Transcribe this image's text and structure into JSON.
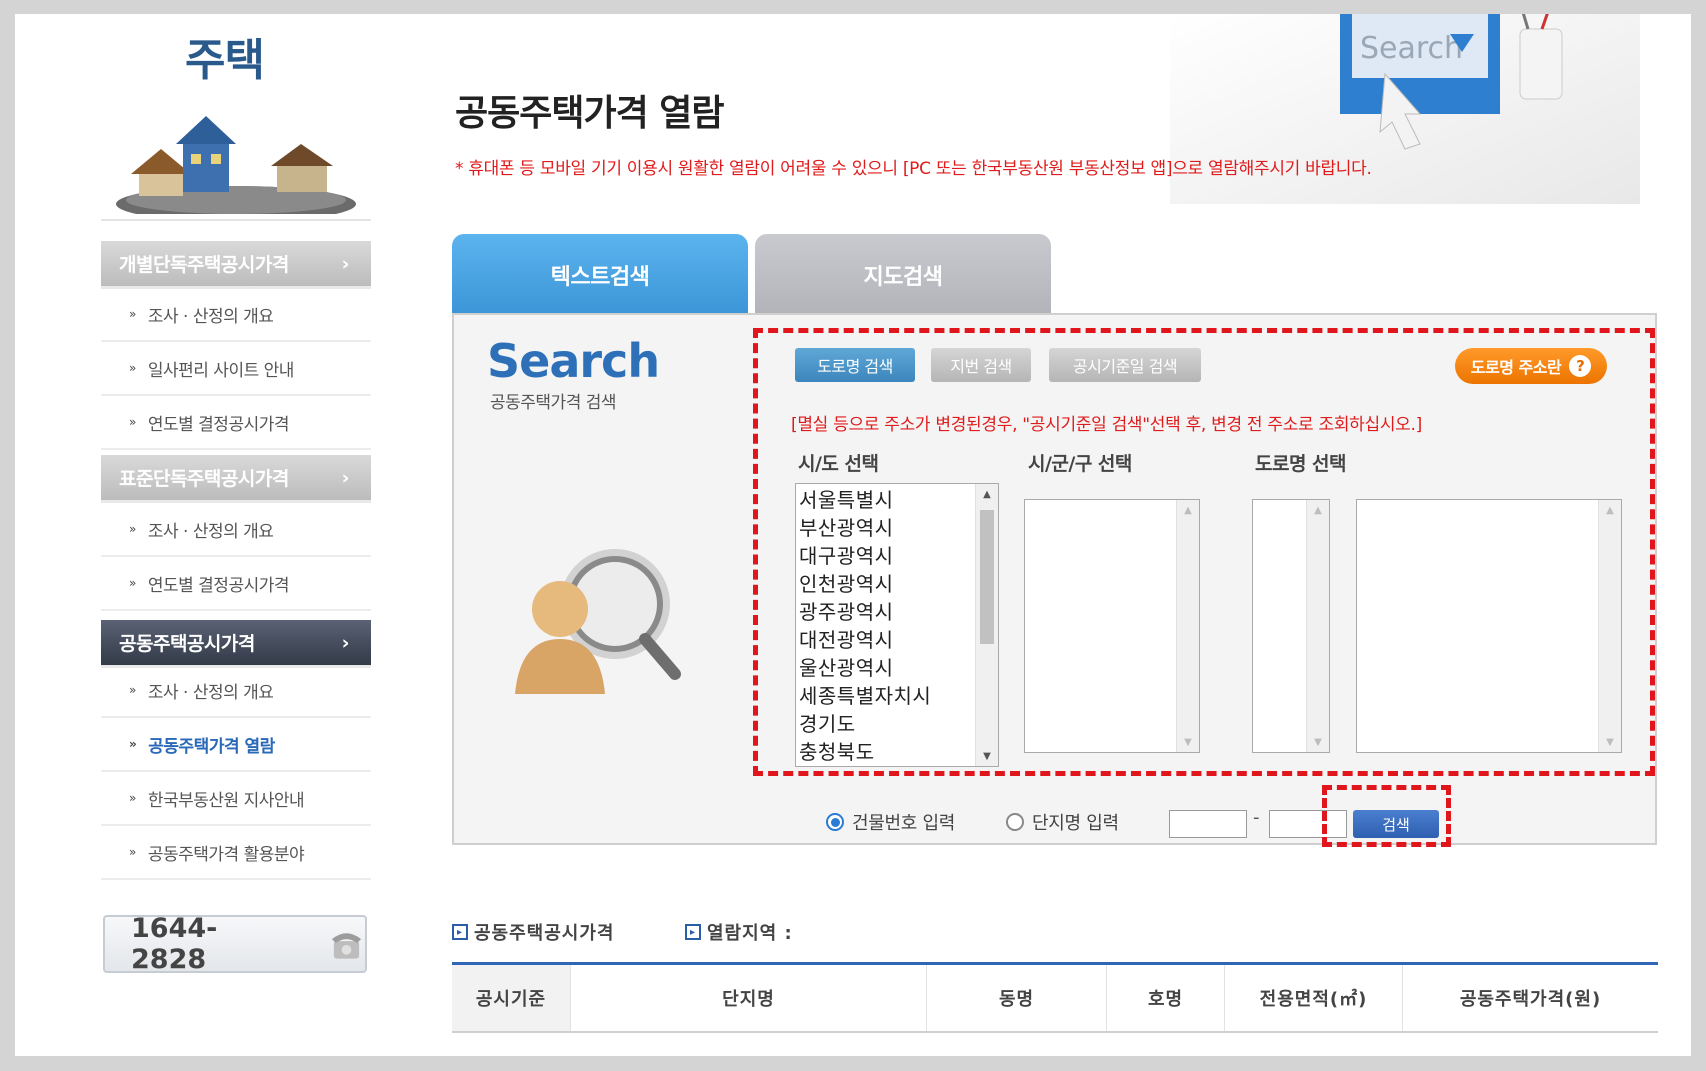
{
  "sidebar": {
    "title": "주택",
    "menu": [
      {
        "type": "head",
        "label": "개별단독주택공시가격",
        "arrow": "›"
      },
      {
        "type": "item",
        "label": "조사 · 산정의 개요"
      },
      {
        "type": "item",
        "label": "일사편리 사이트 안내"
      },
      {
        "type": "item",
        "label": "연도별 결정공시가격"
      },
      {
        "type": "head",
        "label": "표준단독주택공시가격",
        "arrow": "›"
      },
      {
        "type": "item",
        "label": "조사 · 산정의 개요"
      },
      {
        "type": "item",
        "label": "연도별 결정공시가격"
      },
      {
        "type": "head",
        "label": "공동주택공시가격",
        "arrow": "›",
        "active": true
      },
      {
        "type": "item",
        "label": "조사 · 산정의 개요"
      },
      {
        "type": "item",
        "label": "공동주택가격 열람",
        "current": true
      },
      {
        "type": "item",
        "label": "한국부동산원 지사안내"
      },
      {
        "type": "item",
        "label": "공동주택가격 활용분야"
      }
    ],
    "phone": "1644-2828"
  },
  "main": {
    "title": "공동주택가격 열람",
    "notice": "* 휴대폰 등 모바일 기기 이용시 원활한 열람이 어려울 수 있으니 [PC 또는 한국부동산원 부동산정보 앱]으로 열람해주시기 바랍니다.",
    "decor_search_text": "Search",
    "tabs": [
      {
        "label": "텍스트검색",
        "active": true
      },
      {
        "label": "지도검색",
        "active": false
      }
    ],
    "search_brand": "Search",
    "search_brand_sub": "공동주택가격 검색",
    "subtabs": [
      {
        "label": "도로명 검색",
        "active": true
      },
      {
        "label": "지번 검색",
        "active": false
      },
      {
        "label": "공시기준일 검색",
        "active": false
      }
    ],
    "road_help_button": "도로명 주소란",
    "warning": "[멸실 등으로 주소가 변경된경우, \"공시기준일 검색\"선택 후, 변경 전 주소로 조회하십시오.]",
    "labels": {
      "sido": "시/도 선택",
      "sigungu": "시/군/구 선택",
      "road": "도로명 선택"
    },
    "sido_options": [
      "서울특별시",
      "부산광역시",
      "대구광역시",
      "인천광역시",
      "광주광역시",
      "대전광역시",
      "울산광역시",
      "세종특별자치시",
      "경기도",
      "충청북도"
    ],
    "radio": [
      {
        "label": "건물번호 입력",
        "checked": true
      },
      {
        "label": "단지명 입력",
        "checked": false
      }
    ],
    "number_separator": "-",
    "search_button": "검색",
    "legend": [
      {
        "label": "공동주택공시가격"
      },
      {
        "label": "열람지역 :"
      }
    ],
    "table_headers": [
      "공시기준",
      "단지명",
      "동명",
      "호명",
      "전용면적(㎡)",
      "공동주택가격(원)"
    ]
  }
}
